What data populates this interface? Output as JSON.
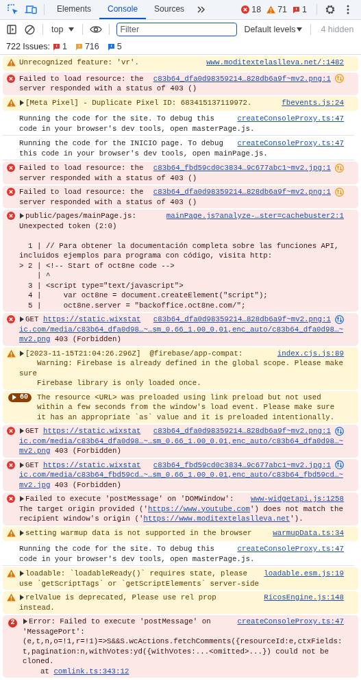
{
  "tabs": [
    {
      "label": "Elements",
      "selected": false
    },
    {
      "label": "Console",
      "selected": true
    },
    {
      "label": "Sources",
      "selected": false
    }
  ],
  "counters": [
    {
      "kind": "error",
      "count": "18"
    },
    {
      "kind": "warning",
      "count": "71"
    },
    {
      "kind": "issue",
      "count": "1"
    }
  ],
  "toolbar": {
    "context": "top",
    "filter_placeholder": "Filter",
    "levels": "Default levels",
    "hidden": "4 hidden"
  },
  "issues": {
    "label": "722 Issues:",
    "counts": [
      {
        "kind": "error",
        "count": "1"
      },
      {
        "kind": "warning",
        "count": "716"
      },
      {
        "kind": "info",
        "count": "5"
      }
    ]
  },
  "messages": [
    {
      "kind": "warning",
      "expandable": false,
      "source": "www.moditextelaslleva.net/:1482",
      "lines": [
        "Unrecognized feature: 'vr'."
      ]
    },
    {
      "kind": "error",
      "expandable": false,
      "source": "c83b64_dfa0d98359214…828db6a9f~mv2.png:1",
      "request": {
        "kind": "failed"
      },
      "lines": [
        "Failed to load resource: the",
        "server responded with a status of 403 ()"
      ]
    },
    {
      "kind": "warning",
      "expandable": true,
      "source": "fbevents.js:24",
      "lines": [
        "[Meta Pixel] - Duplicate Pixel ID: 683415137119972."
      ]
    },
    {
      "kind": "log",
      "expandable": false,
      "source": "createConsoleProxy.ts:47",
      "lines": [
        "Running the code for the site. To debug this",
        "code in your browser's dev tools, open masterPage.js."
      ]
    },
    {
      "kind": "log",
      "expandable": false,
      "source": "createConsoleProxy.ts:47",
      "lines": [
        "Running the code for the INICIO page. To debug",
        "this code in your browser's dev tools, open mainPage.js."
      ]
    },
    {
      "kind": "error",
      "expandable": false,
      "source": "c83b64_fbd59cd0c3834…9c677abc1~mv2.jpg:1",
      "request": {
        "kind": "failed"
      },
      "lines": [
        "Failed to load resource: the",
        "server responded with a status of 403 ()"
      ]
    },
    {
      "kind": "error",
      "expandable": false,
      "source": "c83b64_dfa0d98359214…828db6a9f~mv2.png:1",
      "request": {
        "kind": "failed"
      },
      "lines": [
        "Failed to load resource: the",
        "server responded with a status of 403 ()"
      ]
    },
    {
      "kind": "error",
      "expandable": true,
      "source": "mainPage.js?analyze-…ster=cachebuster2:1",
      "lines": [
        "public/pages/mainPage.js:",
        "Unexpected token (2:0)"
      ],
      "code_lines": [
        "  1 | // Para obtener la documentación completa sobre las funciones API, incluidos ejemplos para programa con código, visita http:",
        "> 2 | <!-- Start of oct8ne code -->",
        "    | ^",
        "  3 | <script type=\"text/javascript\">",
        "  4 |     var oct8ne = document.createElement(\"script\");",
        "  5 |     oct8ne.server = \"backoffice.oct8ne.com/\";"
      ]
    },
    {
      "kind": "error",
      "expandable": true,
      "source": "c83b64_dfa0d98359214…828db6a9f~mv2.png:1",
      "request": {
        "kind": "network"
      },
      "lines": [
        [
          {
            "text": "GET ",
            "link": false
          },
          {
            "text": "https://static.wixstat",
            "link": true
          }
        ],
        [
          {
            "text": "ic.com/media/c83b64_dfa0d98…~…sm_0.66_1.00_0.01,enc_auto/c83b64_dfa0d98…~",
            "link": true
          }
        ],
        [
          {
            "text": "mv2.png",
            "link": true
          },
          {
            "text": " 403 (Forbidden)",
            "link": false
          }
        ]
      ]
    },
    {
      "kind": "warning",
      "expandable": true,
      "source": "index.cjs.js:89",
      "lines": [
        "[2023-11-15T21:04:26.296Z]  @firebase/app-compat:",
        "    Warning: Firebase is already defined in the global scope. Please make sure",
        "    Firebase library is only loaded once."
      ]
    },
    {
      "kind": "warning",
      "expandable": true,
      "count": "60",
      "grouped": true,
      "lines": [
        "The resource <URL> was preloaded using link preload but not used",
        "within a few seconds from the window's load event. Please make sure",
        "it has an appropriate `as` value and it is preloaded intentionally."
      ]
    },
    {
      "kind": "error",
      "expandable": true,
      "source": "c83b64_dfa0d98359214…828db6a9f~mv2.png:1",
      "request": {
        "kind": "network"
      },
      "lines": [
        [
          {
            "text": "GET ",
            "link": false
          },
          {
            "text": "https://static.wixstat",
            "link": true
          }
        ],
        [
          {
            "text": "ic.com/media/c83b64_dfa0d98…~…sm_0.66_1.00_0.01,enc_auto/c83b64_dfa0d98…~",
            "link": true
          }
        ],
        [
          {
            "text": "mv2.png",
            "link": true
          },
          {
            "text": " 403 (Forbidden)",
            "link": false
          }
        ]
      ]
    },
    {
      "kind": "error",
      "expandable": true,
      "source": "c83b64_fbd59cd0c3834…9c677abc1~mv2.jpg:1",
      "request": {
        "kind": "network"
      },
      "lines": [
        [
          {
            "text": "GET ",
            "link": false
          },
          {
            "text": "https://static.wixstat",
            "link": true
          }
        ],
        [
          {
            "text": "ic.com/media/c83b64_fbd59cd…~…sm_0.66_1.00_0.01,enc_auto/c83b64_fbd59cd…~",
            "link": true
          }
        ],
        [
          {
            "text": "mv2.jpg",
            "link": true
          },
          {
            "text": " 403 (Forbidden)",
            "link": false
          }
        ]
      ]
    },
    {
      "kind": "error",
      "expandable": true,
      "source": "www-widgetapi.js:1258",
      "lines": [
        "Failed to execute 'postMessage' on 'DOMWindow':",
        [
          {
            "text": "The target origin provided ('",
            "link": false
          },
          {
            "text": "https://www.youtube.com",
            "link": true
          },
          {
            "text": "') does not match the",
            "link": false
          }
        ],
        [
          {
            "text": "recipient window's origin ('",
            "link": false
          },
          {
            "text": "https://www.moditextelaslleva.net",
            "link": true
          },
          {
            "text": "').",
            "link": false
          }
        ]
      ]
    },
    {
      "kind": "warning",
      "expandable": true,
      "source": "warmupData.ts:34",
      "lines": [
        "setting warmup data is not supported in the browser"
      ]
    },
    {
      "kind": "log",
      "expandable": false,
      "source": "createConsoleProxy.ts:47",
      "lines": [
        "Running the code for the site. To debug this",
        "code in your browser's dev tools, open masterPage.js."
      ]
    },
    {
      "kind": "warning",
      "expandable": true,
      "source": "loadable.esm.js:19",
      "lines": [
        "loadable: `loadableReady()` requires state, please",
        "use `getScriptTags` or `getScriptElements` server-side"
      ]
    },
    {
      "kind": "warning",
      "expandable": true,
      "source": "RicosEngine.js:148",
      "lines": [
        "relValue is deprecated, Please use rel prop",
        "instead."
      ]
    },
    {
      "kind": "error",
      "expandable": true,
      "count": "2",
      "grouped": false,
      "source": "createConsoleProxy.ts:47",
      "lines": [
        "Error: Failed to execute 'postMessage' on",
        "'MessagePort':",
        "(e,t,n,o=!1,r=!1)=>S&&S.wcActions.fetchComments({resourceId:e,ctxFields:",
        "t,pagination:n,withVotes:yd({withVotes:...<omitted>...}) could not be",
        "cloned.",
        [
          {
            "text": "    at ",
            "link": false
          },
          {
            "text": "comlink.ts:343:12",
            "link": true
          }
        ]
      ]
    }
  ]
}
